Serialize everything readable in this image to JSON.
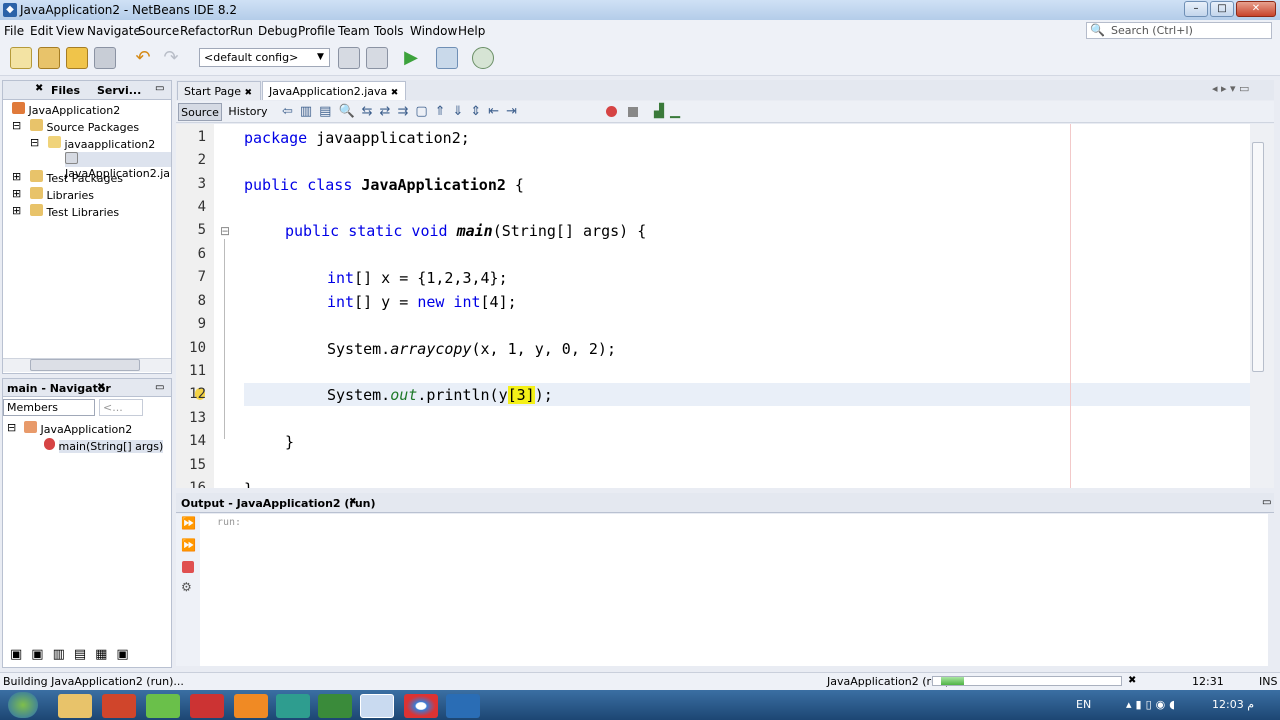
{
  "window": {
    "title": "JavaApplication2 - NetBeans IDE 8.2"
  },
  "menu": [
    "File",
    "Edit",
    "View",
    "Navigate",
    "Source",
    "Refactor",
    "Run",
    "Debug",
    "Profile",
    "Team",
    "Tools",
    "Window",
    "Help"
  ],
  "toolbar": {
    "config": "<default config>",
    "search_placeholder": "Search (Ctrl+I)"
  },
  "projects": {
    "tabs": [
      "Files",
      "Servi..."
    ],
    "tree": [
      "JavaApplication2",
      "Source Packages",
      "javaapplication2",
      "JavaApplication2.ja",
      "Test Packages",
      "Libraries",
      "Test Libraries"
    ]
  },
  "navigator": {
    "title": "main - Navigator",
    "filter": "Members",
    "filter2": "<...",
    "tree": [
      "JavaApplication2",
      "main(String[] args)"
    ]
  },
  "editor": {
    "tabs": [
      "Start Page",
      "JavaApplication2.java"
    ],
    "view_tabs": [
      "Source",
      "History"
    ],
    "line_numbers": [
      "1",
      "2",
      "3",
      "4",
      "5",
      "6",
      "7",
      "8",
      "9",
      "10",
      "11",
      "12",
      "13",
      "14",
      "15",
      "16"
    ],
    "lines": {
      "l1a": "package",
      "l1b": " javaapplication2;",
      "l3a": "public class",
      "l3b": " ",
      "l3c": "JavaApplication2",
      "l3d": " {",
      "l5a": "public static void",
      "l5b": " ",
      "l5c": "main",
      "l5d": "(String[] args) {",
      "l7a": "int",
      "l7b": "[] x = {1,2,3,4};",
      "l8a": "int",
      "l8b": "[] y = ",
      "l8c": "new int",
      "l8d": "[4];",
      "l10a": "System.",
      "l10b": "arraycopy",
      "l10c": "(x, 1, y, 0, 2);",
      "l12a": "System.",
      "l12b": "out",
      "l12c": ".println(y",
      "l12d": "[3]",
      "l12e": ");",
      "l14": "}",
      "l16": "}"
    }
  },
  "output": {
    "title": "Output - JavaApplication2 (run)",
    "text": "run:"
  },
  "status": {
    "left": "Building JavaApplication2 (run)...",
    "task": "JavaApplication2 (run)",
    "position": "12:31",
    "mode": "INS",
    "progress": 0.13
  },
  "taskbar": {
    "lang": "EN",
    "clock": "12:03 م"
  }
}
